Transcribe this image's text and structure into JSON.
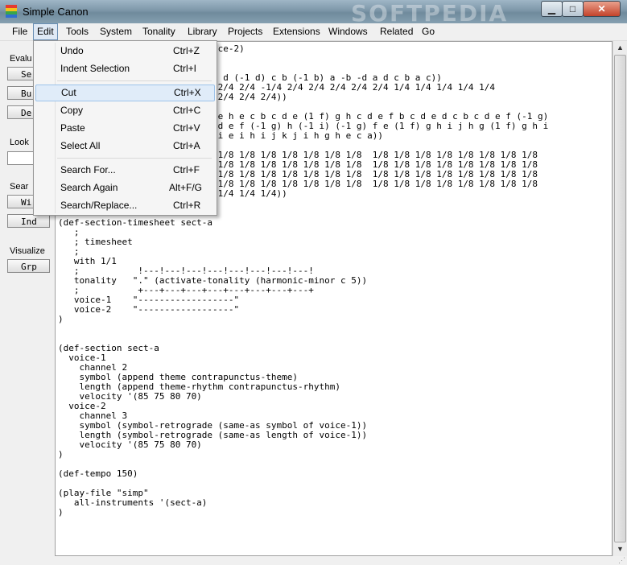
{
  "window": {
    "title": "Simple Canon",
    "watermark": "SOFTPEDIA"
  },
  "menubar": [
    "File",
    "Edit",
    "Tools",
    "System",
    "Tonality",
    "Library",
    "Projects",
    "Extensions",
    "Windows",
    "Related",
    "Go"
  ],
  "edit_menu": {
    "items": [
      {
        "label": "Undo",
        "shortcut": "Ctrl+Z"
      },
      {
        "label": "Indent Selection",
        "shortcut": "Ctrl+I"
      },
      {
        "label": "Cut",
        "shortcut": "Ctrl+X"
      },
      {
        "label": "Copy",
        "shortcut": "Ctrl+C"
      },
      {
        "label": "Paste",
        "shortcut": "Ctrl+V"
      },
      {
        "label": "Select All",
        "shortcut": "Ctrl+A"
      },
      {
        "label": "Search For...",
        "shortcut": "Ctrl+F"
      },
      {
        "label": "Search Again",
        "shortcut": "Alt+F/G"
      },
      {
        "label": "Search/Replace...",
        "shortcut": "Ctrl+R"
      }
    ]
  },
  "panel": {
    "evaluate_label": "Evalu",
    "buttons_top": [
      "Se",
      "Bu",
      "De"
    ],
    "look_label": "Look",
    "search_label": "Sear",
    "search_buttons": [
      "Wi",
      "Ind"
    ],
    "visualize_label": "Visualize",
    "grp_button": "Grp"
  },
  "editor": {
    "text": "                           voice-2)\n\n\n                          1 e) d (-1 d) c b (-1 b) a -b -d a d c b a c))\n                          2/4 2/4 2/4 -1/4 2/4 2/4 2/4 2/4 2/4 1/4 1/4 1/4 1/4 1/4\n                          2/4 2/4 2/4 2/4))\n\n                          e d e h e c b c d e (1 f) g h c d e f b c d e d c b c d e f (-1 g)\n                          f e d e f (-1 g) h (-1 i) (-1 g) f e (1 f) g h i j h g (1 f) g h i\n                          j k i e i h i j k j i h g h e c a))\n\n                          1/8 1/8 1/8 1/8 1/8 1/8 1/8 1/8  1/8 1/8 1/8 1/8 1/8 1/8 1/8 1/8\n                          1/8 1/8 1/8 1/8 1/8 1/8 1/8 1/8  1/8 1/8 1/8 1/8 1/8 1/8 1/8 1/8\n                          1/8 1/8 1/8 1/8 1/8 1/8 1/8 1/8  1/8 1/8 1/8 1/8 1/8 1/8 1/8 1/8\n                          1/8 1/8 1/8 1/8 1/8 1/8 1/8 1/8  1/8 1/8 1/8 1/8 1/8 1/8 1/8 1/8\n                          1/4 1/4 1/4 1/4))\n\n\n(def-section-timesheet sect-a\n   ;\n   ; timesheet\n   ;\n   with 1/1\n   ;           !---!---!---!---!---!---!---!---!\n   tonality   \".\" (activate-tonality (harmonic-minor c 5))\n   ;           +---+---+---+---+---+---+---+---+\n   voice-1    \"------------------\"\n   voice-2    \"------------------\"\n)\n\n\n(def-section sect-a\n  voice-1\n    channel 2\n    symbol (append theme contrapunctus-theme)\n    length (append theme-rhythm contrapunctus-rhythm)\n    velocity '(85 75 80 70)\n  voice-2\n    channel 3\n    symbol (symbol-retrograde (same-as symbol of voice-1))\n    length (symbol-retrograde (same-as length of voice-1))\n    velocity '(85 75 80 70)\n)\n\n(def-tempo 150)\n\n(play-file \"simp\"\n   all-instruments '(sect-a)\n)"
  }
}
